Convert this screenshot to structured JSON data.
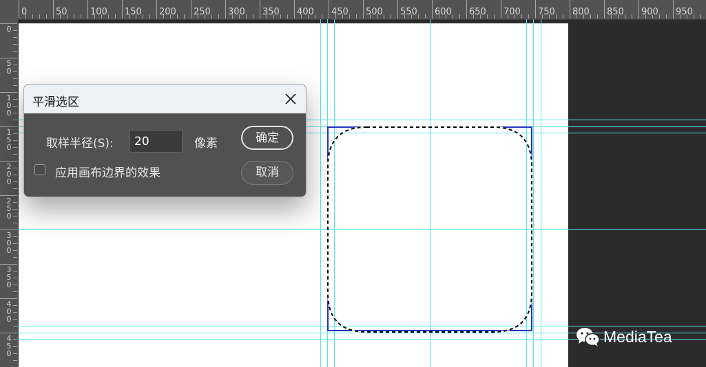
{
  "ruler": {
    "top_labels": [
      "0",
      "50",
      "100",
      "150",
      "200",
      "250",
      "300",
      "350",
      "400",
      "450",
      "500",
      "550",
      "600",
      "650",
      "700",
      "750",
      "800",
      "850",
      "900",
      "950"
    ],
    "left_labels": [
      [
        "0"
      ],
      [
        "5",
        "0"
      ],
      [
        "1",
        "0",
        "0"
      ],
      [
        "1",
        "5",
        "0"
      ],
      [
        "2",
        "0",
        "0"
      ],
      [
        "2",
        "5",
        "0"
      ],
      [
        "3",
        "0",
        "0"
      ],
      [
        "3",
        "5",
        "0"
      ],
      [
        "4",
        "0",
        "0"
      ],
      [
        "4",
        "5",
        "0"
      ]
    ]
  },
  "dialog": {
    "title": "平滑选区",
    "radius_label": "取样半径(S):",
    "radius_value": "20",
    "unit": "像素",
    "apply_canvas_label": "应用画布边界的效果",
    "apply_canvas_checked": false,
    "ok_label": "确定",
    "cancel_label": "取消"
  },
  "watermark": {
    "icon": "wechat-icon",
    "text": "MediaTea"
  },
  "colors": {
    "guide": "#55e6ea",
    "selection_rect": "#2233c8",
    "ruler_bg": "#535353",
    "dialog_bg": "#515151",
    "dialog_title_bg": "#eef0f7"
  }
}
